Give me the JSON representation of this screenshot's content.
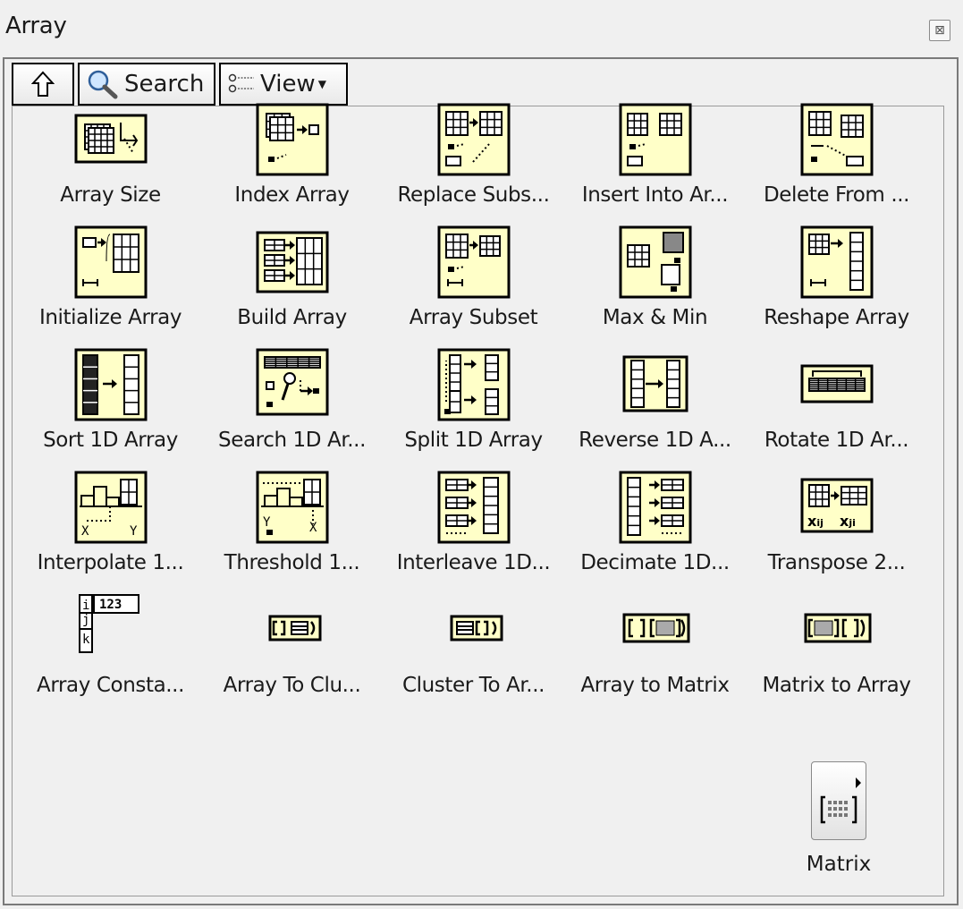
{
  "window": {
    "title": "Array",
    "close_glyph": "⊠"
  },
  "toolbar": {
    "up_label": "",
    "search_label": "Search",
    "view_label": "View"
  },
  "items": [
    {
      "label": "Array Size",
      "icon": "array-size-icon"
    },
    {
      "label": "Index Array",
      "icon": "index-array-icon"
    },
    {
      "label": "Replace Subs...",
      "icon": "replace-subset-icon"
    },
    {
      "label": "Insert Into Ar...",
      "icon": "insert-into-array-icon"
    },
    {
      "label": "Delete From ...",
      "icon": "delete-from-array-icon"
    },
    {
      "label": "Initialize Array",
      "icon": "initialize-array-icon"
    },
    {
      "label": "Build Array",
      "icon": "build-array-icon"
    },
    {
      "label": "Array Subset",
      "icon": "array-subset-icon"
    },
    {
      "label": "Max & Min",
      "icon": "max-min-icon"
    },
    {
      "label": "Reshape Array",
      "icon": "reshape-array-icon"
    },
    {
      "label": "Sort 1D Array",
      "icon": "sort-1d-array-icon"
    },
    {
      "label": "Search 1D Ar...",
      "icon": "search-1d-array-icon"
    },
    {
      "label": "Split 1D Array",
      "icon": "split-1d-array-icon"
    },
    {
      "label": "Reverse 1D A...",
      "icon": "reverse-1d-array-icon"
    },
    {
      "label": "Rotate 1D Ar...",
      "icon": "rotate-1d-array-icon"
    },
    {
      "label": "Interpolate 1...",
      "icon": "interpolate-1d-icon"
    },
    {
      "label": "Threshold 1...",
      "icon": "threshold-1d-icon"
    },
    {
      "label": "Interleave 1D...",
      "icon": "interleave-1d-icon"
    },
    {
      "label": "Decimate 1D...",
      "icon": "decimate-1d-icon"
    },
    {
      "label": "Transpose 2...",
      "icon": "transpose-2d-icon"
    },
    {
      "label": "Array Consta...",
      "icon": "array-constant-icon"
    },
    {
      "label": "Array To Clu...",
      "icon": "array-to-cluster-icon"
    },
    {
      "label": "Cluster To Ar...",
      "icon": "cluster-to-array-icon"
    },
    {
      "label": "Array to Matrix",
      "icon": "array-to-matrix-icon"
    },
    {
      "label": "Matrix to Array",
      "icon": "matrix-to-array-icon"
    }
  ],
  "array_constant_text": "123",
  "matrix": {
    "label": "Matrix",
    "icon": "matrix-subpalette-icon"
  },
  "colors": {
    "icon_fill": "#ffffc8",
    "icon_border": "#000000",
    "background": "#f0f0f0"
  }
}
